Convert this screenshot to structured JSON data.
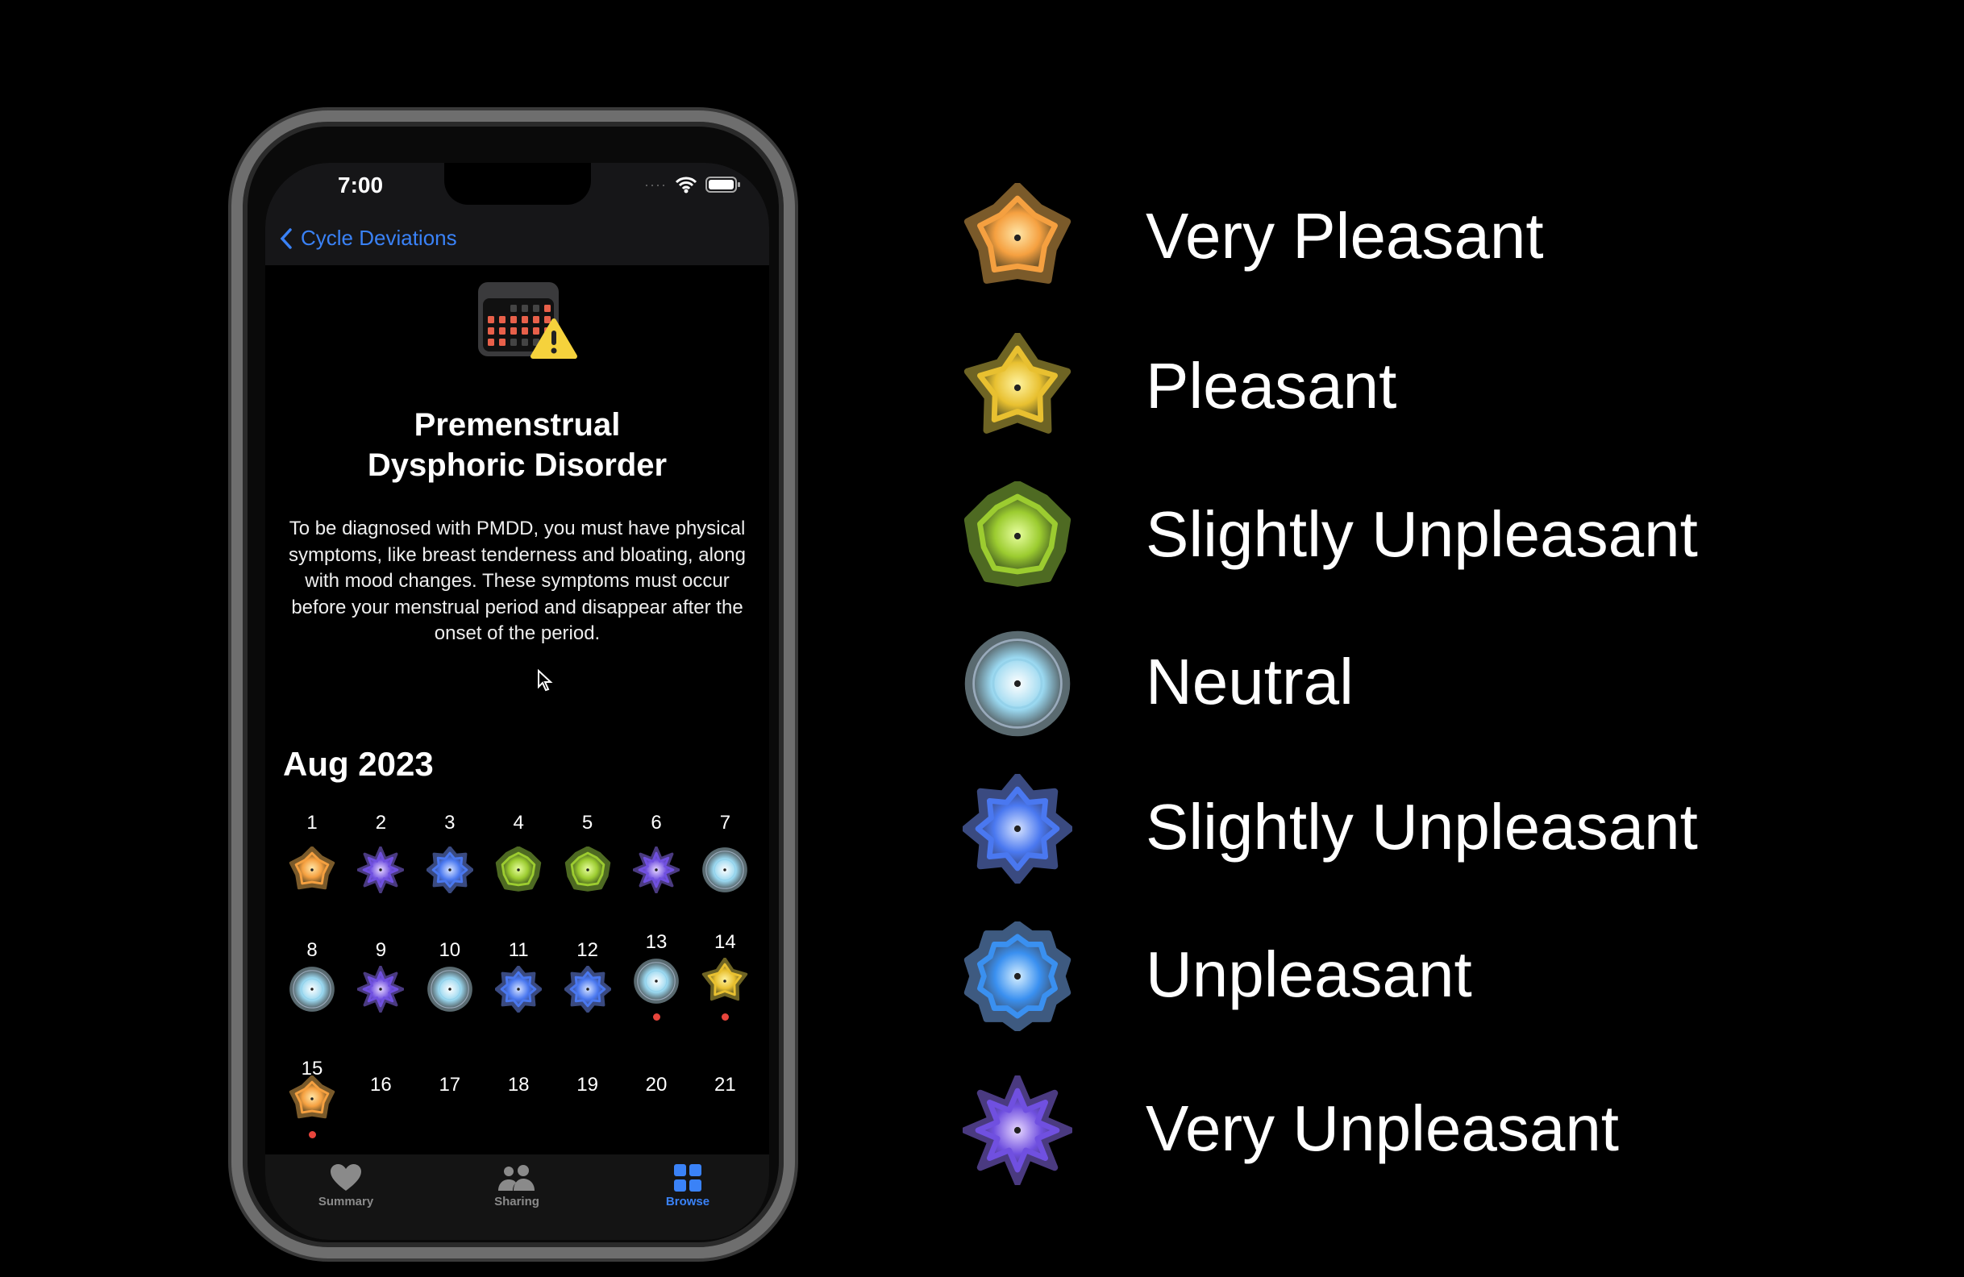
{
  "status_bar": {
    "time": "7:00"
  },
  "nav": {
    "back_label": "Cycle Deviations"
  },
  "article": {
    "title_line1": "Premenstrual",
    "title_line2": "Dysphoric Disorder",
    "body": "To be diagnosed with PMDD, you must have physical symptoms, like breast tenderness and bloating, along with mood changes. These symptoms must occur before your menstrual period and disappear after the onset of the period."
  },
  "calendar": {
    "month": "Aug 2023",
    "days": [
      {
        "d": "1",
        "mood": "very-pleasant"
      },
      {
        "d": "2",
        "mood": "very-unpleasant"
      },
      {
        "d": "3",
        "mood": "slightly-unpleasant"
      },
      {
        "d": "4",
        "mood": "slightly-pleasant"
      },
      {
        "d": "5",
        "mood": "slightly-pleasant"
      },
      {
        "d": "6",
        "mood": "very-unpleasant"
      },
      {
        "d": "7",
        "mood": "neutral"
      },
      {
        "d": "8",
        "mood": "neutral"
      },
      {
        "d": "9",
        "mood": "very-unpleasant"
      },
      {
        "d": "10",
        "mood": "neutral"
      },
      {
        "d": "11",
        "mood": "slightly-unpleasant"
      },
      {
        "d": "12",
        "mood": "slightly-unpleasant"
      },
      {
        "d": "13",
        "mood": "neutral",
        "period": true
      },
      {
        "d": "14",
        "mood": "pleasant",
        "period": true
      },
      {
        "d": "15",
        "mood": "very-pleasant",
        "period": true
      },
      {
        "d": "16"
      },
      {
        "d": "17"
      },
      {
        "d": "18"
      },
      {
        "d": "19"
      },
      {
        "d": "20"
      },
      {
        "d": "21"
      }
    ]
  },
  "tabs": [
    {
      "label": "Summary",
      "icon": "heart-icon",
      "active": false
    },
    {
      "label": "Sharing",
      "icon": "people-icon",
      "active": false
    },
    {
      "label": "Browse",
      "icon": "grid-icon",
      "active": true
    }
  ],
  "legend": [
    {
      "label": "Very Pleasant",
      "mood": "very-pleasant"
    },
    {
      "label": "Pleasant",
      "mood": "pleasant"
    },
    {
      "label": "Slightly Unpleasant",
      "mood": "slightly-pleasant"
    },
    {
      "label": "Neutral",
      "mood": "neutral"
    },
    {
      "label": "Slightly Unpleasant",
      "mood": "slightly-unpleasant"
    },
    {
      "label": "Unpleasant",
      "mood": "unpleasant"
    },
    {
      "label": "Very Unpleasant",
      "mood": "very-unpleasant"
    }
  ],
  "colors": {
    "accent": "#3a82f7",
    "period_dot": "#e8453c",
    "moods": {
      "very-pleasant": [
        "#ffe6a8",
        "#f5a040",
        "#7a5a2a"
      ],
      "pleasant": [
        "#fff3a0",
        "#e8c030",
        "#6e6424"
      ],
      "slightly-pleasant": [
        "#e8ffa0",
        "#9ccc30",
        "#4e6a22"
      ],
      "neutral": [
        "#ffffff",
        "#9ad8f0",
        "#5a6a70"
      ],
      "slightly-unpleasant": [
        "#d8e4ff",
        "#4a78f0",
        "#3a4a80"
      ],
      "unpleasant": [
        "#d8f0ff",
        "#3a90f0",
        "#3e5a80"
      ],
      "very-unpleasant": [
        "#e8d8ff",
        "#7050e0",
        "#4a3a80"
      ]
    }
  }
}
